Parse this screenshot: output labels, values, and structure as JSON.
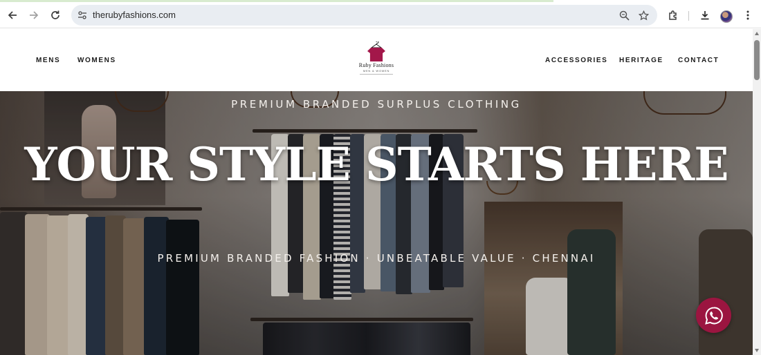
{
  "browser": {
    "url": "therubyfashions.com",
    "icons": [
      "back-arrow-icon",
      "forward-arrow-icon",
      "reload-icon",
      "site-info-icon",
      "zoom-icon",
      "star-icon",
      "extensions-icon",
      "download-icon",
      "profile-avatar",
      "more-menu-icon"
    ]
  },
  "site": {
    "nav_left": [
      "MENS",
      "WOMENS"
    ],
    "nav_right": [
      "ACCESSORIES",
      "HERITAGE",
      "CONTACT"
    ],
    "logo": {
      "brand": "Ruby Fashions",
      "tagline": "MEN & WOMEN"
    }
  },
  "hero": {
    "kicker": "PREMIUM BRANDED SURPLUS CLOTHING",
    "title": "YOUR STYLE STARTS HERE",
    "subtitle": "PREMIUM BRANDED FASHION · UNBEATABLE VALUE · CHENNAI"
  },
  "whatsapp": {
    "icon": "whatsapp-icon"
  },
  "colors": {
    "brand_ruby": "#9b1540",
    "hero_text": "#ffffff"
  }
}
